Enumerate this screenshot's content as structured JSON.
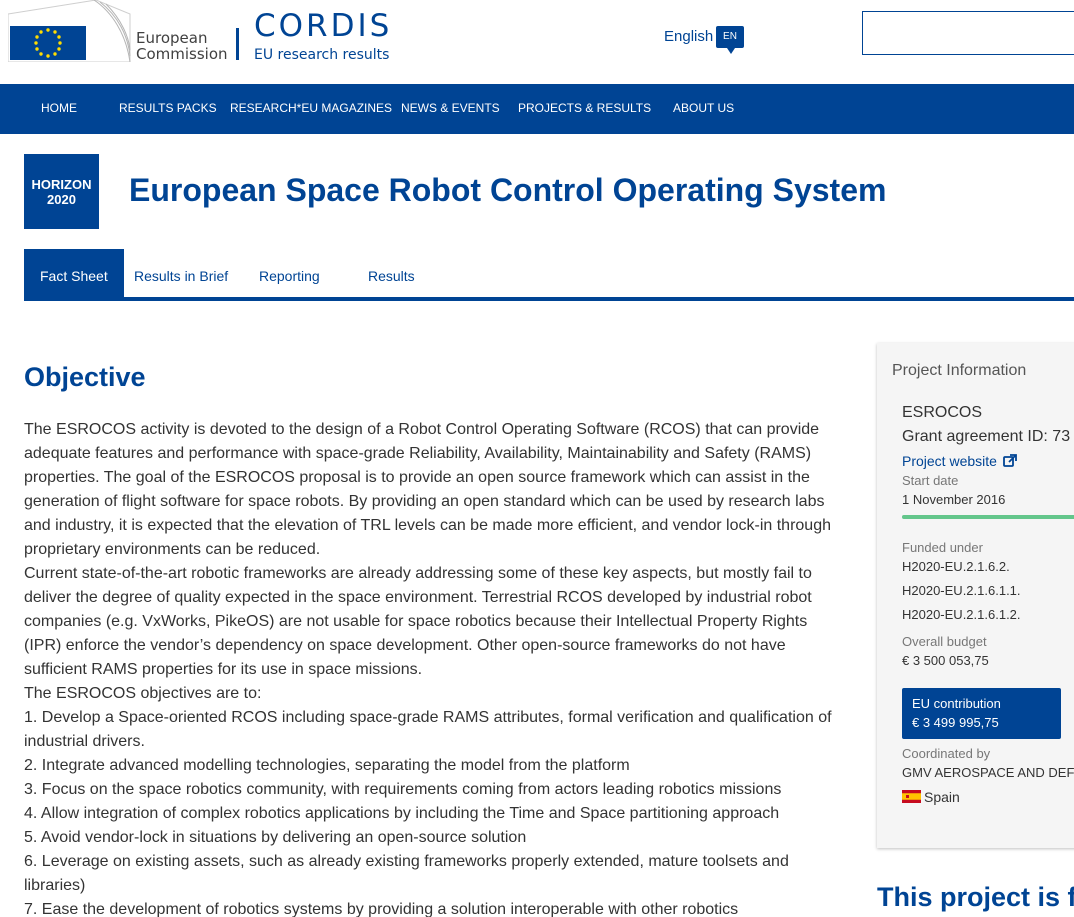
{
  "header": {
    "ec_logo_text_line1": "European",
    "ec_logo_text_line2": "Commission",
    "cordis_title": "CORDIS",
    "cordis_subtitle": "EU research results",
    "language_label": "English",
    "language_code": "EN",
    "search_value": ""
  },
  "nav": {
    "items": [
      "HOME",
      "RESULTS PACKS",
      "RESEARCH*EU MAGAZINES",
      "NEWS & EVENTS",
      "PROJECTS & RESULTS",
      "ABOUT US"
    ]
  },
  "programme_logo": {
    "line1": "HORIZON",
    "line2": "2020"
  },
  "page_title": "European Space Robot Control Operating System",
  "tabs": [
    "Fact Sheet",
    "Results in Brief",
    "Reporting",
    "Results"
  ],
  "objective": {
    "heading": "Objective",
    "paragraphs": [
      "The ESROCOS activity is devoted to the design of a Robot Control Operating Software (RCOS) that can provide adequate features and performance with space-grade Reliability, Availability, Maintainability and Safety (RAMS) properties. The goal of the ESROCOS proposal is to provide an open source framework which can assist in the generation of flight software for space robots. By providing an open standard which can be used by research labs and industry, it is expected that the elevation of TRL levels can be made more efficient, and vendor lock-in through proprietary environments can be reduced.",
      "Current state-of-the-art robotic frameworks are already addressing some of these key aspects, but mostly fail to deliver the degree of quality expected in the space environment. Terrestrial RCOS developed by industrial robot companies (e.g. VxWorks, PikeOS) are not usable for space robotics because their Intellectual Property Rights (IPR) enforce the vendor’s dependency on space development. Other open-source frameworks do not have sufficient RAMS properties for its use in space missions.",
      "The ESROCOS objectives are to:",
      "1. Develop a Space-oriented RCOS including space-grade RAMS attributes, formal verification and qualification of industrial drivers.",
      "2. Integrate advanced modelling technologies, separating the model from the platform",
      "3. Focus on the space robotics community, with requirements coming from actors leading robotics missions",
      "4. Allow integration of complex robotics applications by including the Time and Space partitioning approach",
      "5. Avoid vendor-lock in situations by delivering an open-source solution",
      "6. Leverage on existing assets, such as already existing frameworks properly extended, mature toolsets and libraries)",
      "7. Ease the development of robotics systems by providing a solution interoperable with other robotics"
    ]
  },
  "sidebar": {
    "heading": "Project Information",
    "acronym": "ESROCOS",
    "grant_label": "Grant agreement ID: 73",
    "website_label": "Project website",
    "start_date_label": "Start date",
    "start_date": "1 November 2016",
    "progress_fraction": 1.0,
    "funded_under_label": "Funded under",
    "funded_under": [
      "H2020-EU.2.1.6.2.",
      "H2020-EU.2.1.6.1.1.",
      "H2020-EU.2.1.6.1.2."
    ],
    "budget_label": "Overall budget",
    "budget": "€ 3 500 053,75",
    "eu_contribution_label": "EU contribution",
    "eu_contribution": "€ 3 499 995,75",
    "coordinated_label": "Coordinated by",
    "coordinator": "GMV AEROSPACE AND DEF",
    "country": "Spain"
  },
  "teaser_heading": "This project is f",
  "colors": {
    "brand_blue": "#004494",
    "progress_green": "#63c68b",
    "eu_flag_yellow": "#ffdd00"
  }
}
